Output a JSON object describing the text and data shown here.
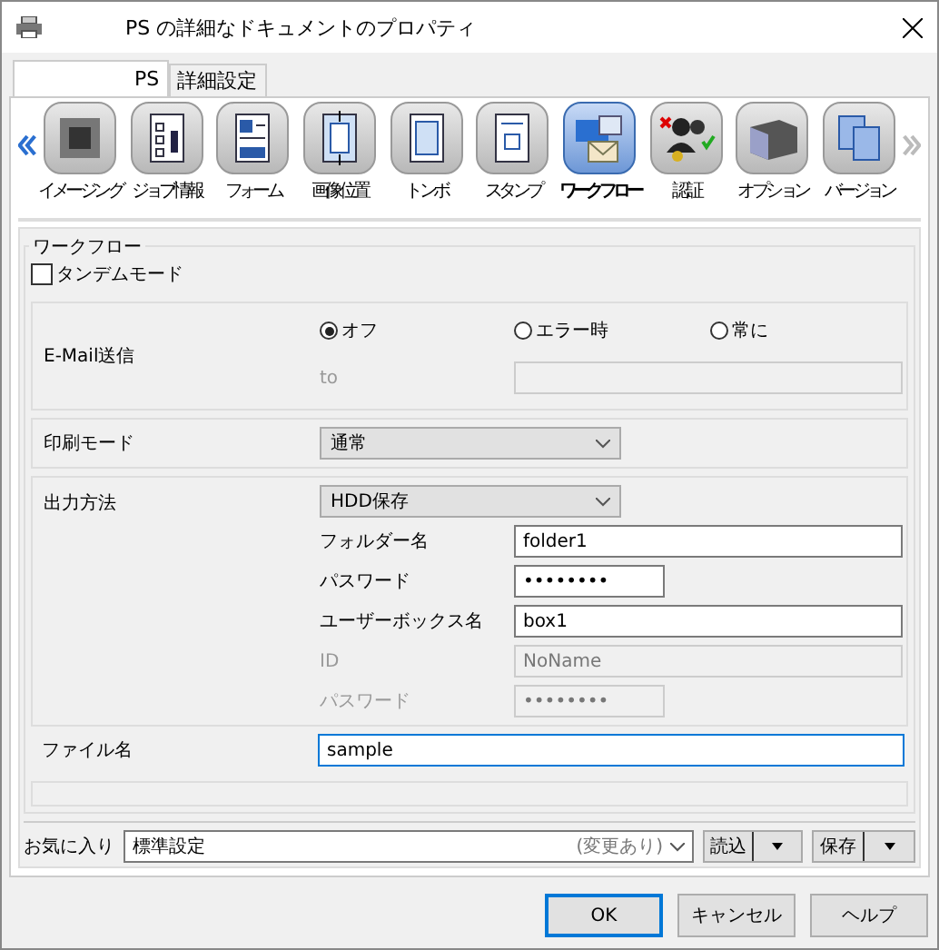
{
  "window": {
    "title": "PS の詳細なドキュメントのプロパティ"
  },
  "tabs": [
    {
      "label": "PS",
      "selected": true
    },
    {
      "label": "詳細設定",
      "selected": false
    }
  ],
  "toolbar": {
    "items": [
      {
        "label": "イメージング",
        "selected": false
      },
      {
        "label": "ジョブ情報",
        "selected": false
      },
      {
        "label": "フォーム",
        "selected": false
      },
      {
        "label": "画像位置",
        "selected": false
      },
      {
        "label": "トンボ",
        "selected": false
      },
      {
        "label": "スタンプ",
        "selected": false
      },
      {
        "label": "ワークフロー",
        "selected": true
      },
      {
        "label": "認証",
        "selected": false
      },
      {
        "label": "オプション",
        "selected": false
      },
      {
        "label": "バージョン",
        "selected": false
      }
    ]
  },
  "workflow": {
    "legend": "ワークフロー",
    "tandem": {
      "label": "タンデムモード",
      "checked": false
    },
    "email": {
      "label": "E-Mail送信",
      "options": [
        {
          "label": "オフ",
          "selected": true
        },
        {
          "label": "エラー時",
          "selected": false
        },
        {
          "label": "常に",
          "selected": false
        }
      ],
      "to_label": "to",
      "to_disabled": true
    },
    "print_mode": {
      "label": "印刷モード",
      "value": "通常"
    },
    "output": {
      "label": "出力方法",
      "value": "HDD保存",
      "fields": [
        {
          "label": "フォルダー名",
          "value": "folder1",
          "kind": "text",
          "disabled": false
        },
        {
          "label": "パスワード",
          "value": "••••••••",
          "kind": "password",
          "disabled": false
        },
        {
          "label": "ユーザーボックス名",
          "value": "box1",
          "kind": "text",
          "disabled": false
        },
        {
          "label": "ID",
          "value": "NoName",
          "kind": "text",
          "disabled": true
        },
        {
          "label": "パスワード",
          "value": "••••••••",
          "kind": "password",
          "disabled": true
        }
      ]
    },
    "file_name": {
      "label": "ファイル名",
      "value": "sample",
      "focused": true
    }
  },
  "favorites": {
    "label": "お気に入り",
    "value": "標準設定",
    "note": "(変更あり)",
    "load": "読込",
    "save": "保存"
  },
  "buttons": [
    {
      "label": "OK",
      "default": true
    },
    {
      "label": "キャンセル",
      "default": false
    },
    {
      "label": "ヘルプ",
      "default": false
    }
  ]
}
